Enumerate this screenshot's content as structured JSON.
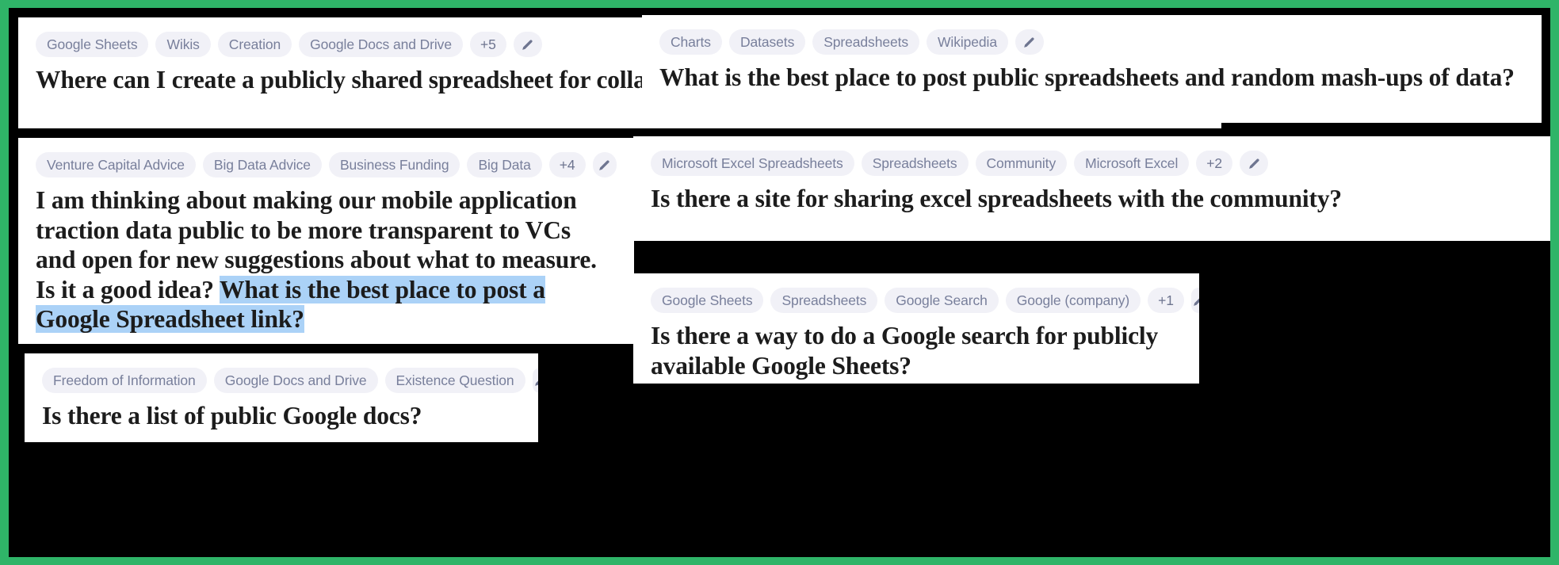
{
  "theme": {
    "frame_color": "#2fb468",
    "background_color": "#000000",
    "card_background": "#ffffff",
    "chip_background": "#f1f1f7",
    "chip_text_color": "#787f9b",
    "title_color": "#1c1c1c",
    "highlight_color": "#abd2f7"
  },
  "cards": [
    {
      "id": "card-1",
      "tags": [
        "Google Sheets",
        "Wikis",
        "Creation",
        "Google Docs and Drive"
      ],
      "overflow_count": "+5",
      "edit_icon": "pencil-icon",
      "title": "Where can I create a publicly shared spreadsheet for collaborative (wiki) editing?"
    },
    {
      "id": "card-2",
      "tags": [
        "Charts",
        "Datasets",
        "Spreadsheets",
        "Wikipedia"
      ],
      "overflow_count": "",
      "edit_icon": "pencil-icon",
      "title": "What is the best place to post public spreadsheets and random mash-ups of data?"
    },
    {
      "id": "card-3",
      "tags": [
        "Venture Capital Advice",
        "Big Data Advice",
        "Business Funding",
        "Big Data"
      ],
      "overflow_count": "+4",
      "edit_icon": "pencil-icon",
      "title_plain": "I am thinking about making our mobile application traction data public to be more transparent to VCs and open for new suggestions about what to measure. Is it a good idea? ",
      "title_highlighted": "What is the best place to post a Google Spreadsheet link?"
    },
    {
      "id": "card-4",
      "tags": [
        "Microsoft Excel Spreadsheets",
        "Spreadsheets",
        "Community",
        "Microsoft Excel"
      ],
      "overflow_count": "+2",
      "edit_icon": "pencil-icon",
      "title": "Is there a site for sharing excel spreadsheets with the community?"
    },
    {
      "id": "card-5",
      "tags": [
        "Freedom of Information",
        "Google Docs and Drive",
        "Existence Question"
      ],
      "overflow_count": "",
      "edit_icon": "pencil-icon",
      "title": "Is there a list of public Google docs?"
    },
    {
      "id": "card-6",
      "tags": [
        "Google Sheets",
        "Spreadsheets",
        "Google Search",
        "Google (company)"
      ],
      "overflow_count": "+1",
      "edit_icon": "pencil-icon",
      "title": "Is there a way to do a Google search for publicly available Google Sheets?"
    }
  ]
}
